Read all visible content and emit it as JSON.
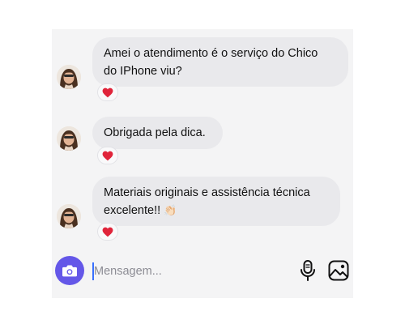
{
  "messages": [
    {
      "lines": [
        "Amei o atendimento é o serviço do Chico",
        "do IPhone viu?"
      ],
      "reaction": "❤️"
    },
    {
      "lines": [
        "Obrigada pela dica."
      ],
      "reaction": "❤️"
    },
    {
      "lines": [
        "Materiais originais e assistência técnica",
        "excelente!!"
      ],
      "emoji": "👏🏻",
      "reaction": "❤️"
    }
  ],
  "composer": {
    "placeholder": "Mensagem..."
  },
  "colors": {
    "accent": "#6457e8",
    "bubble": "#e9e9ec",
    "heart": "#e0243a",
    "caret": "#3870ff"
  },
  "icons": {
    "camera": "camera-icon",
    "mic": "microphone-icon",
    "gallery": "image-gallery-icon",
    "reaction": "heart-icon"
  }
}
